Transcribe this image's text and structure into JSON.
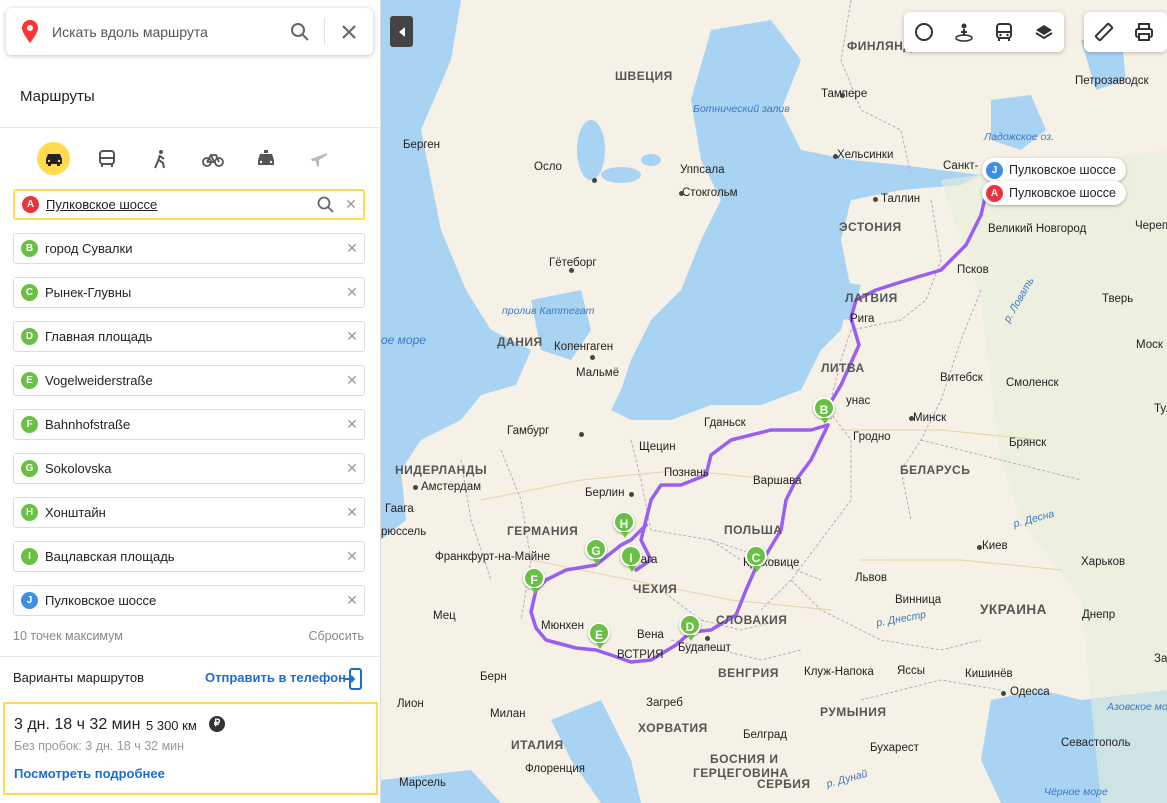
{
  "search": {
    "placeholder": "Искать вдоль маршрута"
  },
  "sidebar": {
    "title": "Маршруты",
    "modes": [
      {
        "name": "car",
        "active": true
      },
      {
        "name": "bus",
        "active": false
      },
      {
        "name": "walk",
        "active": false
      },
      {
        "name": "bike",
        "active": false
      },
      {
        "name": "taxi",
        "active": false
      },
      {
        "name": "plane",
        "active": false
      }
    ],
    "waypoints": [
      {
        "letter": "A",
        "label": "Пулковское шоссе",
        "color": "#e9343d"
      },
      {
        "letter": "B",
        "label": "город Сувалки",
        "color": "#6ac043"
      },
      {
        "letter": "C",
        "label": "Рынек-Глувны",
        "color": "#6ac043"
      },
      {
        "letter": "D",
        "label": "Главная площадь",
        "color": "#6ac043"
      },
      {
        "letter": "E",
        "label": "Vogelweiderstraße",
        "color": "#6ac043"
      },
      {
        "letter": "F",
        "label": "Bahnhofstraße",
        "color": "#6ac043"
      },
      {
        "letter": "G",
        "label": "Sokolovska",
        "color": "#6ac043"
      },
      {
        "letter": "H",
        "label": "Хонштайн",
        "color": "#6ac043"
      },
      {
        "letter": "I",
        "label": "Вацлавская площадь",
        "color": "#6ac043"
      },
      {
        "letter": "J",
        "label": "Пулковское шоссе",
        "color": "#3d8ee6"
      }
    ],
    "max_points": "10 точек максимум",
    "reset": "Сбросить",
    "variants_label": "Варианты маршрутов",
    "send_to_phone": "Отправить в телефон",
    "route": {
      "time": "3 дн. 18 ч 32 мин",
      "distance": "5 300 км",
      "toll_symbol": "₽",
      "no_traffic": "Без пробок: 3 дн. 18 ч 32 мин",
      "details": "Посмотреть подробнее"
    }
  },
  "map": {
    "flags": {
      "J": {
        "letter": "J",
        "label": "Пулковское шоссе",
        "color": "#3d8ee6"
      },
      "A": {
        "letter": "A",
        "label": "Пулковское шоссе",
        "color": "#e9343d"
      }
    },
    "pins": [
      "B",
      "C",
      "D",
      "E",
      "F",
      "G",
      "H",
      "I"
    ],
    "countries": {
      "finland": "ФИНЛЯНД",
      "sweden": "ШВЕЦИЯ",
      "estonia": "ЭСТОНИЯ",
      "latvia": "ЛАТВИЯ",
      "lithuania": "ЛИТВА",
      "denmark": "ДАНИЯ",
      "belarus": "БЕЛАРУСЬ",
      "poland": "ПОЛЬША",
      "germany": "ГЕРМАНИЯ",
      "netherlands": "НИДЕРЛАНДЫ",
      "czechia": "ЧЕХИЯ",
      "slovakia": "СЛОВАКИЯ",
      "hungary": "ВЕНГРИЯ",
      "ukraine": "УКРАИНА",
      "romania": "РУМЫНИЯ",
      "italy": "ИТАЛИЯ",
      "croatia": "ХОРВАТИЯ",
      "bosnia1": "БОСНИЯ И",
      "bosnia2": "ГЕРЦЕГОВИНА",
      "serbia": "СЕРБИЯ"
    },
    "cities": {
      "tampere": "Тампере",
      "petrozavodsk": "Петрозаводск",
      "bergen": "Берген",
      "oslo": "Осло",
      "uppsala": "Уппсала",
      "helsinki": "Хельсинки",
      "stockholm": "Стокгольм",
      "tallinn": "Таллин",
      "spb": "Санкт-",
      "novgorod": "Великий Новгород",
      "cherep": "Череп",
      "goteborg": "Гётеборг",
      "pskov": "Псков",
      "riga": "Рига",
      "tver": "Тверь",
      "copenhagen": "Копенгаген",
      "malmo": "Мальмё",
      "mosk": "Моск",
      "vitebsk": "Витебск",
      "smolensk": "Смоленск",
      "kaunas": "унас",
      "gdansk": "Гданьск",
      "minsk": "Минск",
      "tula": "Тула",
      "hamburg": "Гамбург",
      "grodno": "Гродно",
      "szczecin": "Щецин",
      "bryansk": "Брянск",
      "poznan": "Познань",
      "amsterdam": "Амстердам",
      "berlin": "Берлин",
      "warsaw": "Варшава",
      "gaaga": "Гаага",
      "brussels": "рюссель",
      "frankfurt": "Франкфурт-на-Майне",
      "praha": "Прага",
      "krakow": "Краковице",
      "kiev": "Киев",
      "kharkov": "Харьков",
      "lvov": "Львов",
      "mets": "Мец",
      "munich": "Мюнхен",
      "vinnitsa": "Винница",
      "dnepr": "Днепр",
      "vena": "Вена",
      "budapest": "Будапешт",
      "austria": "ВСТРИЯ",
      "bern": "Берн",
      "klujnapoka": "Клуж-Напока",
      "iasi": "Яссы",
      "kishinev": "Кишинёв",
      "zap": "За",
      "odessa": "Одесса",
      "lion": "Лион",
      "milan": "Милан",
      "zagreb": "Загреб",
      "sevastopol": "Севастополь",
      "belgrad": "Белград",
      "buharest": "Бухарест",
      "florence": "Флоренция",
      "marseille": "Марсель"
    },
    "water": {
      "bothnian": "Ботнический залив",
      "ladoga": "Ладожское оз.",
      "kattegat": "пролив Каттегат",
      "north_sea": "ое море",
      "lovat": "р. Ловать",
      "desna": "р. Десна",
      "dnestr": "р. Днестр",
      "dunai": "р. Дунай",
      "azov": "Азовское мо",
      "black_sea": "Чёрное море"
    }
  }
}
